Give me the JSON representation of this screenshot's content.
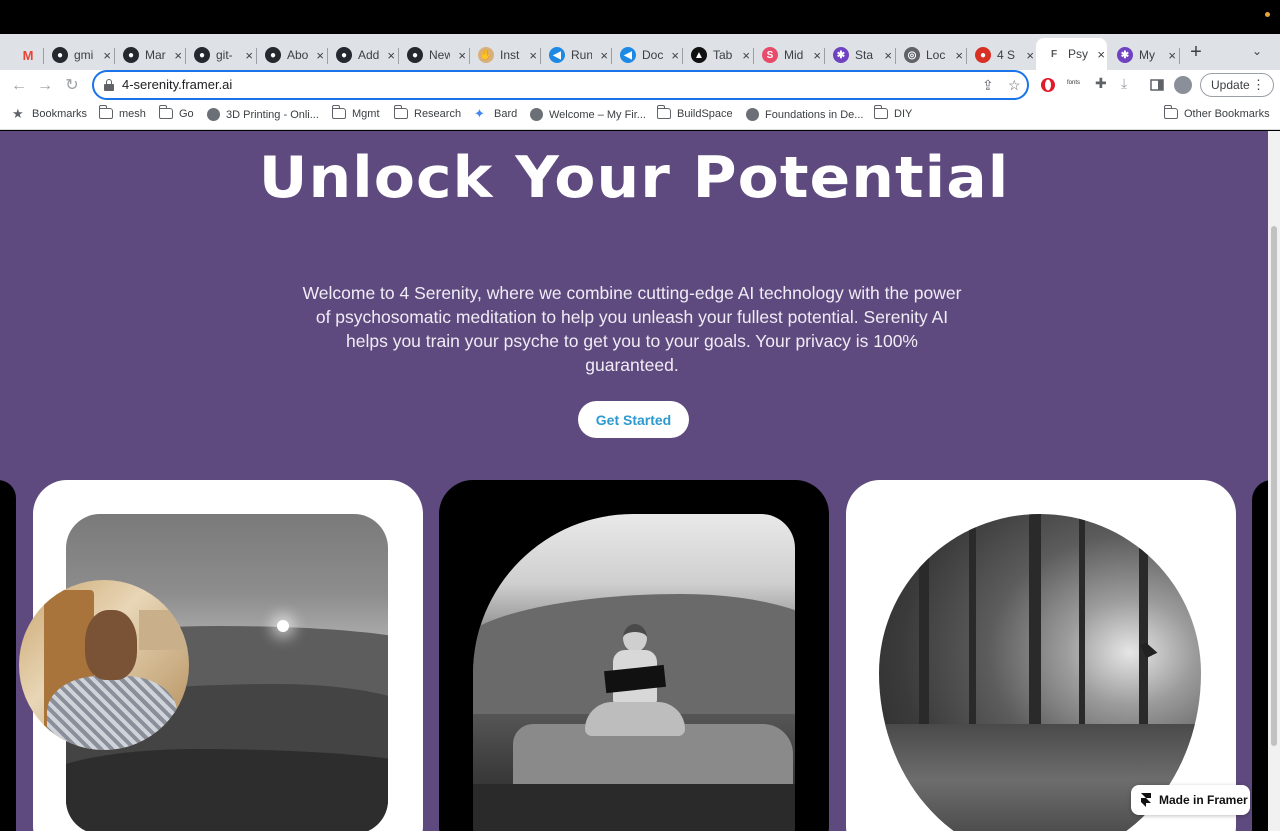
{
  "browser": {
    "tabs": [
      {
        "icon": "gmail-icon",
        "title": "",
        "color": "#ea4335",
        "glyph": "M"
      },
      {
        "icon": "github-icon",
        "title": "gmi",
        "color": "#24292f",
        "glyph": "●"
      },
      {
        "icon": "github-icon",
        "title": "Mar",
        "color": "#24292f",
        "glyph": "●"
      },
      {
        "icon": "github-icon",
        "title": "git-",
        "color": "#24292f",
        "glyph": "●"
      },
      {
        "icon": "github-icon",
        "title": "Abo",
        "color": "#24292f",
        "glyph": "●"
      },
      {
        "icon": "github-icon",
        "title": "Add",
        "color": "#24292f",
        "glyph": "●"
      },
      {
        "icon": "github-icon",
        "title": "New",
        "color": "#24292f",
        "glyph": "●"
      },
      {
        "icon": "hand-icon",
        "title": "Inst",
        "color": "#d9b07a",
        "glyph": "✋"
      },
      {
        "icon": "vscode-icon",
        "title": "Run",
        "color": "#1e88e5",
        "glyph": "◀"
      },
      {
        "icon": "vscode-icon",
        "title": "Doc",
        "color": "#1e88e5",
        "glyph": "◀"
      },
      {
        "icon": "tableau-icon",
        "title": "Tab",
        "color": "#111111",
        "glyph": "▲"
      },
      {
        "icon": "midjourney-icon",
        "title": "Mid",
        "color": "#e84a6a",
        "glyph": "S"
      },
      {
        "icon": "stability-icon",
        "title": "Sta",
        "color": "#6f42c1",
        "glyph": "✱"
      },
      {
        "icon": "globe-icon",
        "title": "Loc",
        "color": "#5f6368",
        "glyph": "◎"
      },
      {
        "icon": "serenity-icon",
        "title": "4 S",
        "color": "#d93025",
        "glyph": "●"
      },
      {
        "icon": "framer-icon",
        "title": "Psy",
        "color": "#ffffff",
        "glyph": "F",
        "active": true
      },
      {
        "icon": "stability-icon",
        "title": "My",
        "color": "#6f42c1",
        "glyph": "✱"
      }
    ],
    "url": "4-serenity.framer.ai",
    "update_label": "Update",
    "fonts_ext_label": "fonts",
    "bookmarks": [
      {
        "icon": "star-icon",
        "label": "Bookmarks"
      },
      {
        "icon": "folder-icon",
        "label": "mesh"
      },
      {
        "icon": "folder-icon",
        "label": "Go"
      },
      {
        "icon": "site-icon",
        "label": "3D Printing - Onli..."
      },
      {
        "icon": "folder-icon",
        "label": "Mgmt"
      },
      {
        "icon": "folder-icon",
        "label": "Research"
      },
      {
        "icon": "bard-icon",
        "label": "Bard"
      },
      {
        "icon": "site-icon",
        "label": "Welcome – My Fir..."
      },
      {
        "icon": "folder-icon",
        "label": "BuildSpace"
      },
      {
        "icon": "site-icon",
        "label": "Foundations in De..."
      },
      {
        "icon": "folder-icon",
        "label": "DIY"
      }
    ],
    "other_bookmarks": "Other Bookmarks"
  },
  "page": {
    "hero_title": "Unlock Your Potential",
    "hero_body": "Welcome to 4 Serenity, where we combine cutting-edge AI technology with the power of psychosomatic meditation to help you unleash your fullest potential. Serenity AI helps you train your psyche to get you to your goals. Your privacy is 100% guaranteed.",
    "cta_label": "Get Started",
    "badge_label": "Made in Framer"
  },
  "colors": {
    "page_bg": "#5e4a7e",
    "accent": "#2e9ad0",
    "omnibox_border": "#1a73e8"
  }
}
